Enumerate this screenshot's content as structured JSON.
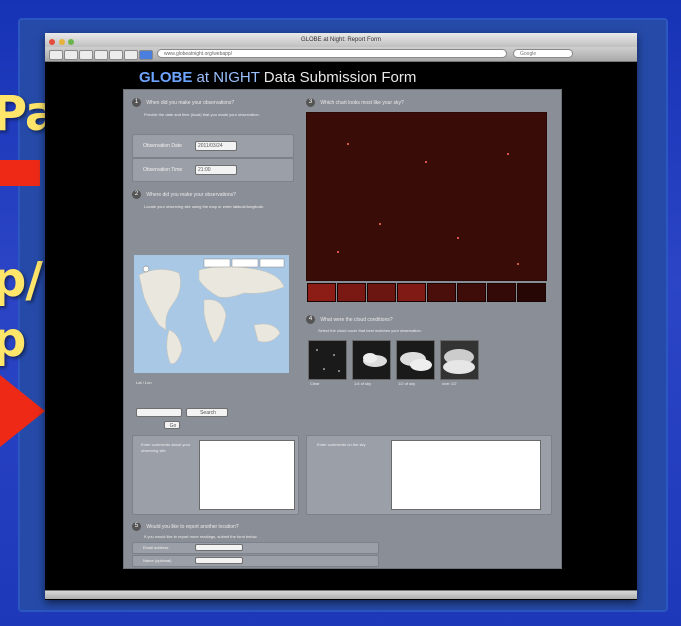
{
  "slide": {
    "side_text": [
      "Pad",
      "p/",
      "p"
    ]
  },
  "browser": {
    "title": "GLOBE at Night: Report Form",
    "url": "www.globeatnight.org/webapp/",
    "search_placeholder": "Google"
  },
  "form": {
    "logo": "GLOBE",
    "logo2": "at NIGHT",
    "heading": "Data Submission Form",
    "section1": {
      "number": "1",
      "title": "When did you make your observations?",
      "help": "Provide the date and time (local) that you made your observation.",
      "date_label": "Observation Date",
      "date_value": "2011/03/24",
      "time_label": "Observation Time",
      "time_value": "21:00"
    },
    "section2": {
      "number": "2",
      "title": "Where did you make your observations?",
      "help": "Locate your observing site using the map or enter latitude/longitude.",
      "map_search_value": "",
      "map_search_button": "Search",
      "coords": "Lat / Lon",
      "go_button": "Go"
    },
    "section3": {
      "number": "3",
      "title": "Which chart looks most like your sky?",
      "chart_count": 8
    },
    "section4": {
      "number": "4",
      "title": "What were the cloud conditions?",
      "help": "Select the cloud cover that best matches your observation.",
      "options": [
        "Clear",
        "1/4 of sky",
        "1/2 of sky",
        "over 1/2"
      ]
    },
    "comments": {
      "label_left": "Enter comments about your observing site",
      "label_right": "Enter comments on the sky"
    },
    "section5": {
      "number": "5",
      "title": "Would you like to report another location?",
      "help": "If you would like to report more readings, submit the form below.",
      "field1_label": "Email address",
      "field2_label": "Name (optional)"
    }
  },
  "colors": {
    "slide_bg": "#1f3bbb",
    "accent_red": "#ee2a17",
    "side_text": "#ffe66a",
    "form_bg": "#8a8e97",
    "sky": "#3a0c08"
  }
}
